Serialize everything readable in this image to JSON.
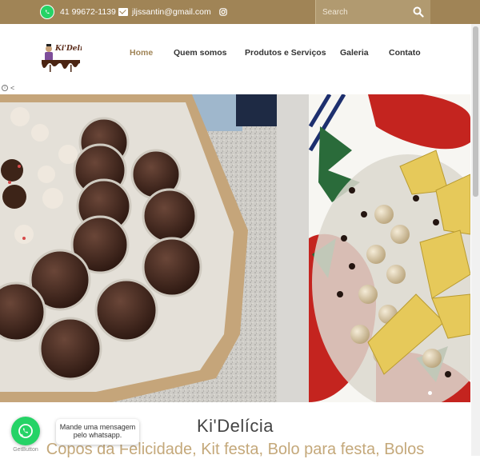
{
  "topbar": {
    "phone": "41 99672-1139",
    "email": "jljssantin@gmail.com",
    "search_placeholder": "Search",
    "colors": {
      "bar": "#a08456",
      "whatsapp": "#25d366"
    },
    "icons": [
      "whatsapp-icon",
      "mail-icon",
      "instagram-icon",
      "search-icon"
    ]
  },
  "logo": {
    "text": "Ki'Delícia"
  },
  "nav": {
    "items": [
      {
        "label": "Home",
        "active": true
      },
      {
        "label": "Quem somos",
        "active": false
      },
      {
        "label": "Produtos e Serviços",
        "active": false
      },
      {
        "label": "Galeria",
        "active": false
      },
      {
        "label": "Contato",
        "active": false
      }
    ],
    "active_color": "#a08456"
  },
  "toggle": {
    "label": "<"
  },
  "slider": {
    "slide_count": 2,
    "active_slide": 1
  },
  "main": {
    "title": "Ki'Delícia",
    "subtitle": "Copos da Felicidade, Kit festa, Bolo para festa, Bolos"
  },
  "whatsapp_widget": {
    "bubble_text": "Mande uma mensagem pelo whatsapp.",
    "brand": "GetButton"
  }
}
